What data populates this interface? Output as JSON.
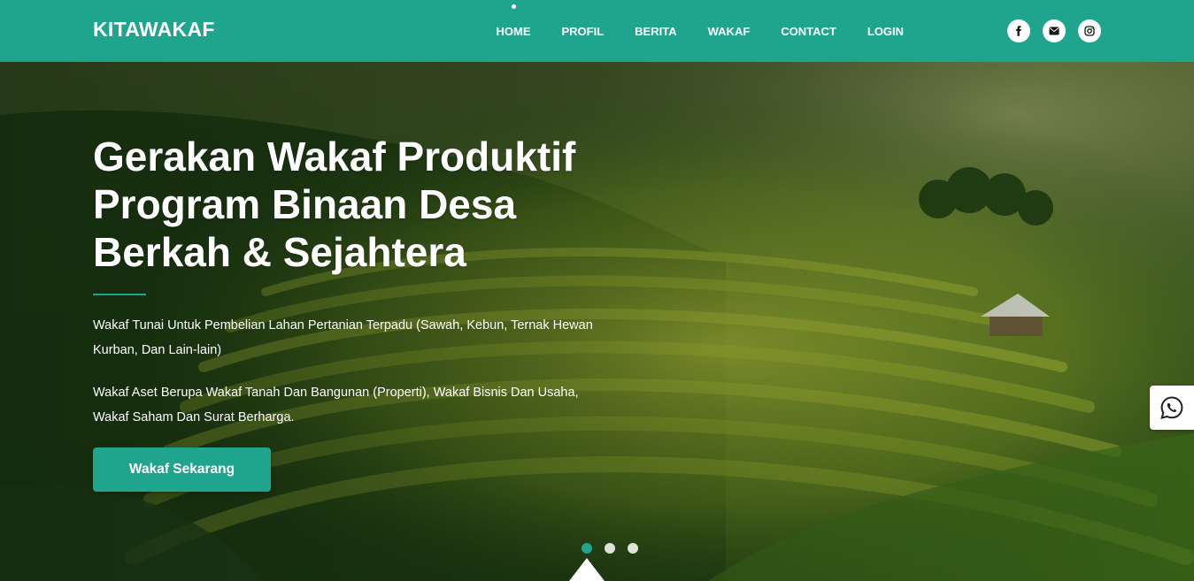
{
  "header": {
    "brand": "KITAWAKAF",
    "nav": [
      {
        "label": "HOME",
        "active": true
      },
      {
        "label": "PROFIL",
        "active": false
      },
      {
        "label": "BERITA",
        "active": false
      },
      {
        "label": "WAKAF",
        "active": false
      },
      {
        "label": "CONTACT",
        "active": false
      },
      {
        "label": "LOGIN",
        "active": false
      }
    ],
    "social_icons": [
      "facebook-icon",
      "envelope-icon",
      "instagram-icon"
    ]
  },
  "hero": {
    "title_lines": [
      "Gerakan Wakaf Produktif",
      "Program Binaan Desa",
      "Berkah & Sejahtera"
    ],
    "paragraphs": [
      "Wakaf Tunai Untuk Pembelian Lahan Pertanian Terpadu (Sawah, Kebun, Ternak Hewan Kurban, Dan Lain-lain)",
      "Wakaf Aset Berupa Wakaf Tanah Dan Bangunan (Properti), Wakaf Bisnis Dan Usaha, Wakaf Saham Dan Surat Berharga."
    ],
    "cta_label": "Wakaf Sekarang",
    "slides_total": 3,
    "active_slide": 1,
    "background": "rice terraces landscape"
  },
  "floating": {
    "whatsapp_icon": "whatsapp-icon"
  },
  "colors": {
    "primary": "#1fa58e",
    "white": "#ffffff"
  }
}
